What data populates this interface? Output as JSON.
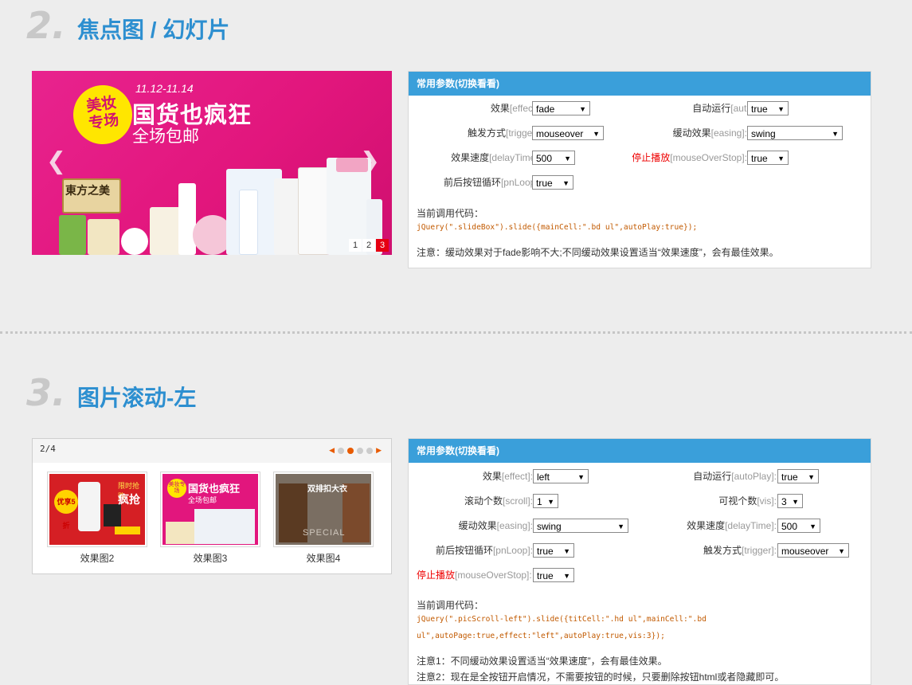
{
  "section2": {
    "num": "2.",
    "title": "焦点图 / 幻灯片",
    "slide": {
      "badge_line1": "美妆",
      "badge_line2": "专场",
      "date": "11.12-11.14",
      "headline": "国货也疯狂",
      "sub": "全场包邮",
      "brand": "東方之美",
      "pages": [
        "1",
        "2",
        "3"
      ],
      "active_page": "3",
      "prev_icon": "chevron-left-icon",
      "next_icon": "chevron-right-icon"
    },
    "panel": {
      "header": "常用参数(切换看看)",
      "effect_zh": "效果",
      "effect_en": "[effect]:",
      "effect_val": "fade",
      "autoplay_zh": "自动运行",
      "autoplay_en": "[autoPlay]:",
      "autoplay_val": "true",
      "trigger_zh": "触发方式",
      "trigger_en": "[trigger]:",
      "trigger_val": "mouseover",
      "easing_zh": "缓动效果",
      "easing_en": "[easing]:",
      "easing_val": "swing",
      "delay_zh": "效果速度",
      "delay_en": "[delayTime]:",
      "delay_val": "500",
      "stop_zh": "停止播放",
      "stop_en": "[mouseOverStop]:",
      "stop_val": "true",
      "loop_zh": "前后按钮循环",
      "loop_en": "[pnLoop]:",
      "loop_val": "true",
      "code_label": "当前调用代码：",
      "code": "jQuery(\".slideBox\").slide({mainCell:\".bd ul\",autoPlay:true});",
      "note": "注意：缓动效果对于fade影响不大;不同缓动效果设置适当“效果速度”，会有最佳效果。"
    }
  },
  "section3": {
    "num": "3.",
    "title": "图片滚动-左",
    "scroll": {
      "pager": "2/4",
      "thumbs": [
        {
          "caption": "效果图2",
          "t1": "限时抢购",
          "t2": "疯抢",
          "t3": "优享5折"
        },
        {
          "caption": "效果图3",
          "t1": "美妆专场",
          "t2": "国货也疯狂",
          "t3": "全场包邮"
        },
        {
          "caption": "效果图4",
          "t1": "双排扣大衣",
          "t2": "SPECIAL",
          "t3": ""
        }
      ]
    },
    "panel": {
      "header": "常用参数(切换看看)",
      "effect_zh": "效果",
      "effect_en": "[effect]:",
      "effect_val": "left",
      "autoplay_zh": "自动运行",
      "autoplay_en": "[autoPlay]:",
      "autoplay_val": "true",
      "scroll_zh": "滚动个数",
      "scroll_en": "[scroll]:",
      "scroll_val": "1",
      "vis_zh": "可视个数",
      "vis_en": "[vis]:",
      "vis_val": "3",
      "easing_zh": "缓动效果",
      "easing_en": "[easing]:",
      "easing_val": "swing",
      "delay_zh": "效果速度",
      "delay_en": "[delayTime]:",
      "delay_val": "500",
      "loop_zh": "前后按钮循环",
      "loop_en": "[pnLoop]:",
      "loop_val": "true",
      "trigger_zh": "触发方式",
      "trigger_en": "[trigger]:",
      "trigger_val": "mouseover",
      "stop_zh": "停止播放",
      "stop_en": "[mouseOverStop]:",
      "stop_val": "true",
      "code_label": "当前调用代码：",
      "code_line1": "jQuery(\".picScroll-left\").slide({titCell:\".hd ul\",mainCell:\".bd",
      "code_line2": "ul\",autoPage:true,effect:\"left\",autoPlay:true,vis:3});",
      "note1": "注意1：不同缓动效果设置适当“效果速度”，会有最佳效果。",
      "note2": "注意2：现在是全按钮开启情况，不需要按钮的时候，只要删除按钮html或者隐藏即可。"
    }
  }
}
